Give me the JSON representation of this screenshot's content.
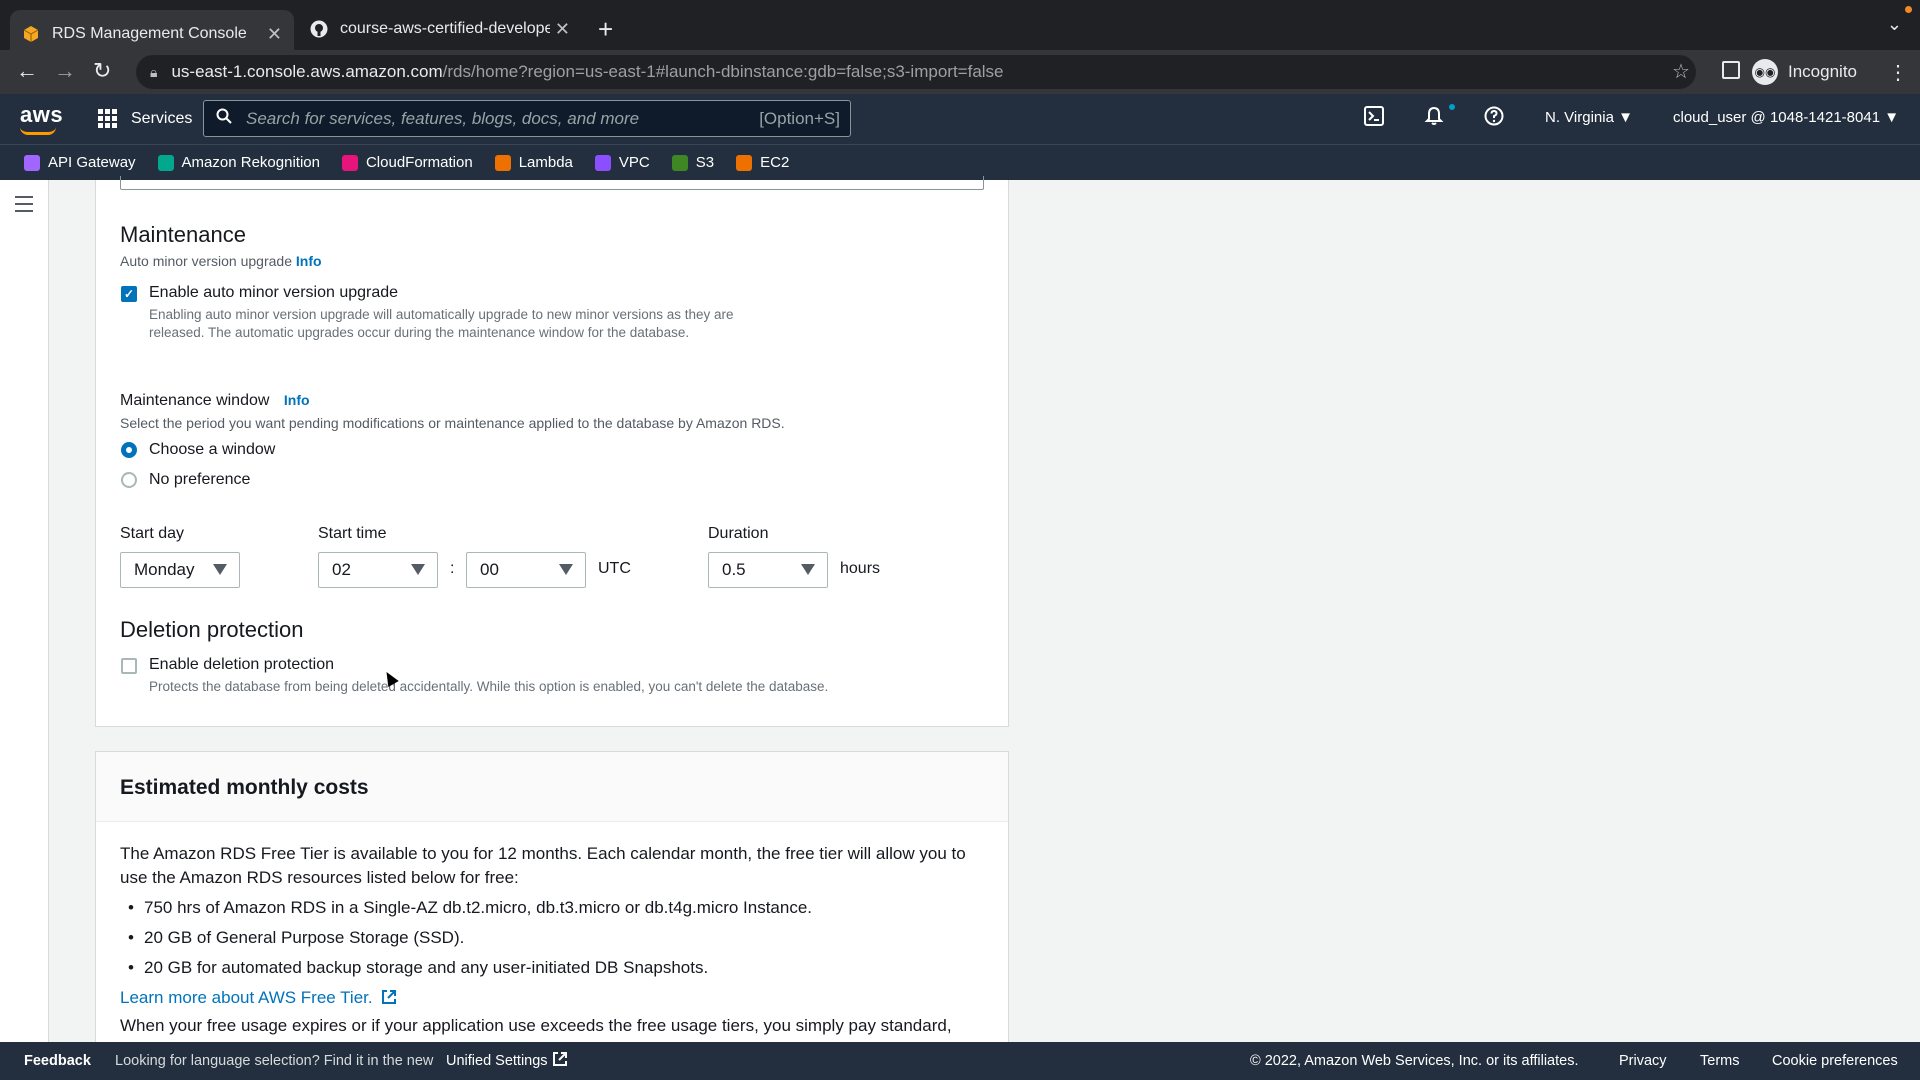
{
  "browser": {
    "tabs": [
      {
        "title": "RDS Management Console",
        "active": true
      },
      {
        "title": "course-aws-certified-develope",
        "active": false
      }
    ],
    "url_host": "us-east-1.console.aws.amazon.com",
    "url_path": "/rds/home?region=us-east-1#launch-dbinstance:gdb=false;s3-import=false",
    "profile": "Incognito"
  },
  "aws_header": {
    "logo": "aws",
    "services": "Services",
    "search_placeholder": "Search for services, features, blogs, docs, and more",
    "search_shortcut": "[Option+S]",
    "region": "N. Virginia",
    "account": "cloud_user @ 1048-1421-8041",
    "favorites": [
      {
        "label": "API Gateway",
        "color": "#a166ff"
      },
      {
        "label": "Amazon Rekognition",
        "color": "#01a88d"
      },
      {
        "label": "CloudFormation",
        "color": "#e7157b"
      },
      {
        "label": "Lambda",
        "color": "#ed7100"
      },
      {
        "label": "VPC",
        "color": "#8c4fff"
      },
      {
        "label": "S3",
        "color": "#3f8624"
      },
      {
        "label": "EC2",
        "color": "#ed7100"
      }
    ]
  },
  "maintenance": {
    "title": "Maintenance",
    "auto_upgrade_label": "Auto minor version upgrade",
    "info": "Info",
    "enable_upgrade_label": "Enable auto minor version upgrade",
    "enable_upgrade_checked": true,
    "enable_upgrade_desc": "Enabling auto minor version upgrade will automatically upgrade to new minor versions as they are released. The automatic upgrades occur during the maintenance window for the database.",
    "window_label": "Maintenance window",
    "window_desc": "Select the period you want pending modifications or maintenance applied to the database by Amazon RDS.",
    "option_choose": "Choose a window",
    "option_none": "No preference",
    "start_day_label": "Start day",
    "start_day_value": "Monday",
    "start_time_label": "Start time",
    "start_hour": "02",
    "start_minute": "00",
    "time_sep": ":",
    "utc": "UTC",
    "duration_label": "Duration",
    "duration_value": "0.5",
    "hours": "hours"
  },
  "deletion": {
    "title": "Deletion protection",
    "enable_label": "Enable deletion protection",
    "enable_checked": false,
    "desc": "Protects the database from being deleted accidentally. While this option is enabled, you can't delete the database."
  },
  "costs": {
    "title": "Estimated monthly costs",
    "intro": "The Amazon RDS Free Tier is available to you for 12 months. Each calendar month, the free tier will allow you to use the Amazon RDS resources listed below for free:",
    "items": [
      "750 hrs of Amazon RDS in a Single-AZ db.t2.micro, db.t3.micro or db.t4g.micro Instance.",
      "20 GB of General Purpose Storage (SSD).",
      "20 GB for automated backup storage and any user-initiated DB Snapshots."
    ],
    "learn_more": "Learn more about AWS Free Tier.",
    "tail": "When your free usage expires or if your application use exceeds the free usage tiers, you simply pay standard,"
  },
  "footer": {
    "feedback": "Feedback",
    "language_note": "Looking for language selection? Find it in the new",
    "unified_settings": "Unified Settings",
    "copyright": "© 2022, Amazon Web Services, Inc. or its affiliates.",
    "privacy": "Privacy",
    "terms": "Terms",
    "cookies": "Cookie preferences"
  }
}
